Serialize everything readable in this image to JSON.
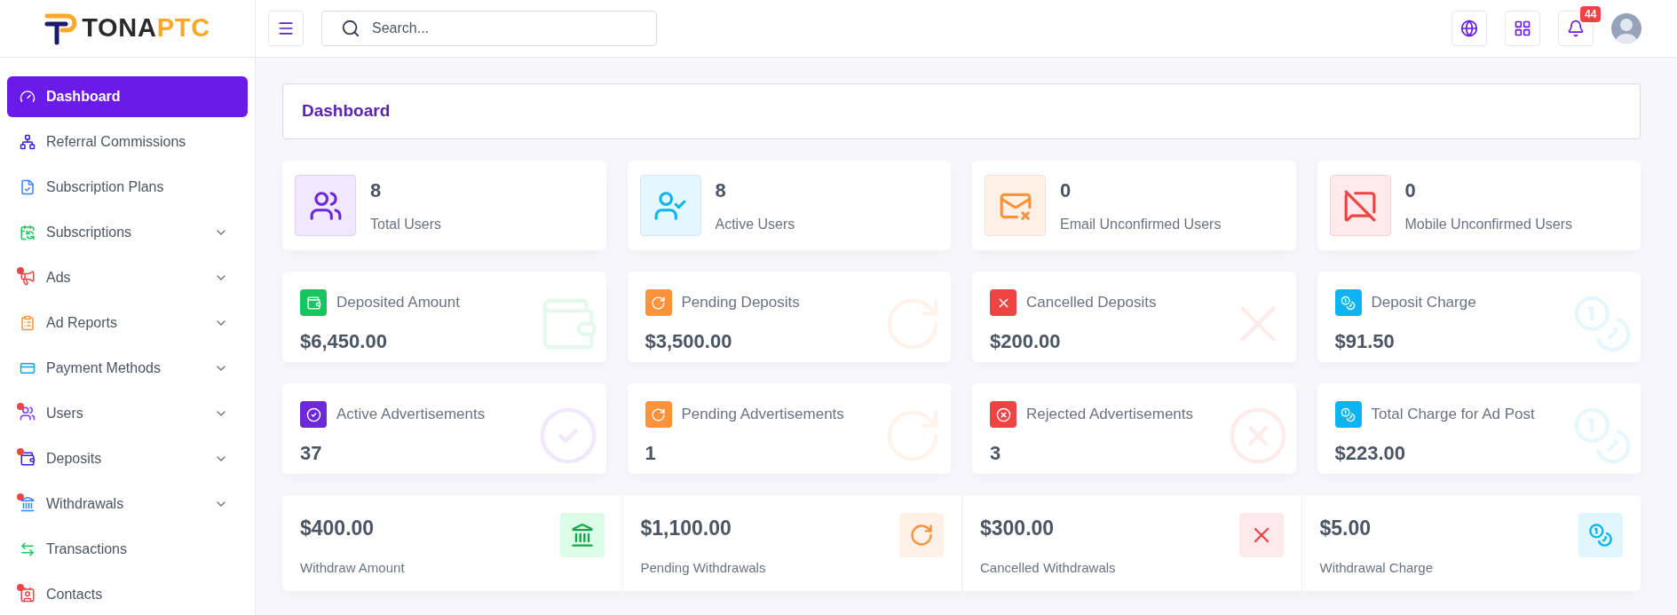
{
  "brand": {
    "name_dark": "TONA",
    "name_accent": "PTC"
  },
  "search": {
    "placeholder": "Search..."
  },
  "notifications": {
    "count": "44"
  },
  "sidebar": {
    "items": [
      {
        "label": "Dashboard",
        "selected": true,
        "alert": false,
        "expandable": false
      },
      {
        "label": "Referral Commissions",
        "selected": false,
        "alert": false,
        "expandable": false
      },
      {
        "label": "Subscription Plans",
        "selected": false,
        "alert": false,
        "expandable": false
      },
      {
        "label": "Subscriptions",
        "selected": false,
        "alert": false,
        "expandable": true
      },
      {
        "label": "Ads",
        "selected": false,
        "alert": true,
        "expandable": true
      },
      {
        "label": "Ad Reports",
        "selected": false,
        "alert": false,
        "expandable": true
      },
      {
        "label": "Payment Methods",
        "selected": false,
        "alert": false,
        "expandable": true
      },
      {
        "label": "Users",
        "selected": false,
        "alert": true,
        "expandable": true
      },
      {
        "label": "Deposits",
        "selected": false,
        "alert": true,
        "expandable": true
      },
      {
        "label": "Withdrawals",
        "selected": false,
        "alert": true,
        "expandable": true
      },
      {
        "label": "Transactions",
        "selected": false,
        "alert": false,
        "expandable": false
      },
      {
        "label": "Contacts",
        "selected": false,
        "alert": true,
        "expandable": false
      }
    ]
  },
  "page_title": "Dashboard",
  "user_stats": [
    {
      "value": "8",
      "label": "Total Users"
    },
    {
      "value": "8",
      "label": "Active Users"
    },
    {
      "value": "0",
      "label": "Email Unconfirmed Users"
    },
    {
      "value": "0",
      "label": "Mobile Unconfirmed Users"
    }
  ],
  "deposit_stats": [
    {
      "label": "Deposited Amount",
      "value": "$6,450.00"
    },
    {
      "label": "Pending Deposits",
      "value": "$3,500.00"
    },
    {
      "label": "Cancelled Deposits",
      "value": "$200.00"
    },
    {
      "label": "Deposit Charge",
      "value": "$91.50"
    }
  ],
  "ad_stats": [
    {
      "label": "Active Advertisements",
      "value": "37"
    },
    {
      "label": "Pending Advertisements",
      "value": "1"
    },
    {
      "label": "Rejected Advertisements",
      "value": "3"
    },
    {
      "label": "Total Charge for Ad Post",
      "value": "$223.00"
    }
  ],
  "withdraw_stats": [
    {
      "value": "$400.00",
      "label": "Withdraw Amount"
    },
    {
      "value": "$1,100.00",
      "label": "Pending Withdrawals"
    },
    {
      "value": "$300.00",
      "label": "Cancelled Withdrawals"
    },
    {
      "value": "$5.00",
      "label": "Withdrawal Charge"
    }
  ]
}
